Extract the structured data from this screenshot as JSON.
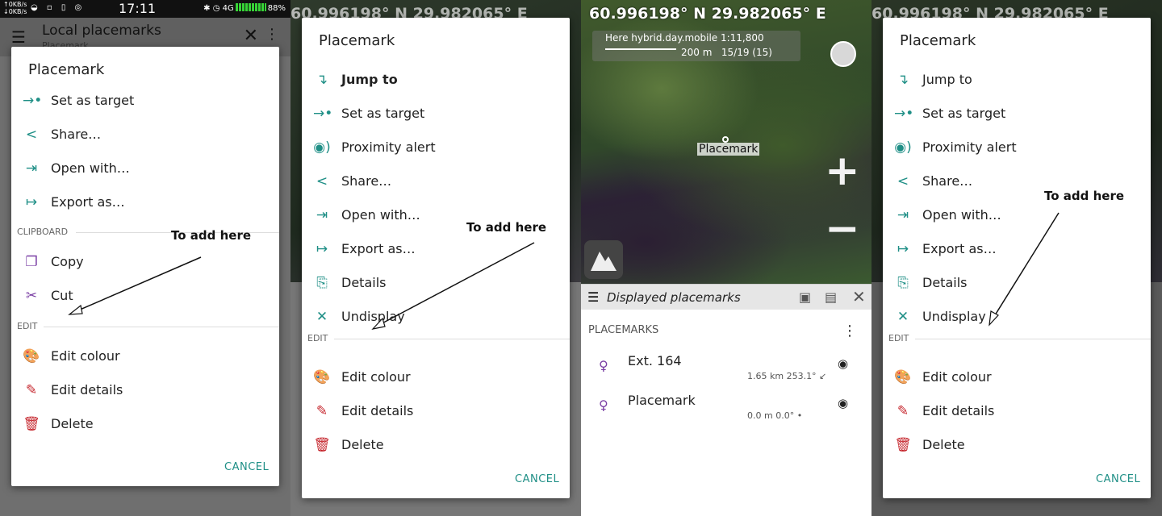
{
  "status": {
    "net_up": "↑0KB/s",
    "net_down": "↓0KB/s",
    "left_icons": "◒ ▫ ▯ ◎",
    "time": "17:11",
    "signal": "4G",
    "battery": "88%"
  },
  "appbar": {
    "title": "Local placemarks",
    "subtitle": "Placemark",
    "menu_icon": "☰",
    "close_icon": "✕",
    "more_icon": "⋮"
  },
  "dialog1": {
    "title": "Placemark",
    "items": [
      {
        "label": "Set as target",
        "icon": "→•"
      },
      {
        "label": "Share…",
        "icon": "<"
      },
      {
        "label": "Open with…",
        "icon": "⇥"
      },
      {
        "label": "Export as…",
        "icon": "↦"
      }
    ],
    "clipboard_header": "CLIPBOARD",
    "clipboard_items": [
      {
        "label": "Copy",
        "icon": "❐"
      },
      {
        "label": "Cut",
        "icon": "✂"
      }
    ],
    "edit_header": "EDIT",
    "edit_items": [
      {
        "label": "Edit colour",
        "icon": "🎨"
      },
      {
        "label": "Edit details",
        "icon": "✎"
      },
      {
        "label": "Delete",
        "icon": "🗑"
      }
    ],
    "cancel": "CANCEL",
    "annotation": "To add here"
  },
  "dialog2": {
    "title": "Placemark",
    "items": [
      {
        "label": "Jump to",
        "icon": "↴"
      },
      {
        "label": "Set as target",
        "icon": "→•"
      },
      {
        "label": "Proximity alert",
        "icon": "◉)"
      },
      {
        "label": "Share…",
        "icon": "<"
      },
      {
        "label": "Open with…",
        "icon": "⇥"
      },
      {
        "label": "Export as…",
        "icon": "↦"
      },
      {
        "label": "Details",
        "icon": "⎘"
      },
      {
        "label": "Undisplay",
        "icon": "✕"
      }
    ],
    "edit_header": "EDIT",
    "edit_items": [
      {
        "label": "Edit colour",
        "icon": "🎨"
      },
      {
        "label": "Edit details",
        "icon": "✎"
      },
      {
        "label": "Delete",
        "icon": "🗑"
      }
    ],
    "cancel": "CANCEL",
    "annotation": "To add here"
  },
  "map": {
    "coordinates": "60.996198° N 29.982065° E",
    "layer_name": "Here hybrid.day.mobile 1:11,800",
    "scale": "200 m",
    "zoom_info": "15/19 (15)",
    "placemark_label": "Placemark",
    "zoom_in": "+",
    "zoom_out": "−"
  },
  "displayed_placemarks": {
    "title": "Displayed placemarks",
    "header": "PLACEMARKS",
    "list_icon": "☰",
    "folder_icon": "▣",
    "filter_icon": "▤",
    "close_icon": "✕",
    "more_icon": "⋮",
    "rows": [
      {
        "name": "Ext. 164",
        "distance": "1.65 km  253.1°  ↙"
      },
      {
        "name": "Placemark",
        "distance": "0.0 m  0.0°  •"
      }
    ]
  },
  "dialog4": {
    "title": "Placemark",
    "items": [
      {
        "label": "Jump to",
        "icon": "↴"
      },
      {
        "label": "Set as target",
        "icon": "→•"
      },
      {
        "label": "Proximity alert",
        "icon": "◉)"
      },
      {
        "label": "Share…",
        "icon": "<"
      },
      {
        "label": "Open with…",
        "icon": "⇥"
      },
      {
        "label": "Export as…",
        "icon": "↦"
      },
      {
        "label": "Details",
        "icon": "⎘"
      },
      {
        "label": "Undisplay",
        "icon": "✕"
      }
    ],
    "edit_header": "EDIT",
    "edit_items": [
      {
        "label": "Edit colour",
        "icon": "🎨"
      },
      {
        "label": "Edit details",
        "icon": "✎"
      },
      {
        "label": "Delete",
        "icon": "🗑"
      }
    ],
    "cancel": "CANCEL",
    "annotation": "To add here"
  },
  "colors": {
    "accent": "#1f8f86",
    "edit_red": "#c6282f",
    "clipboard_purple": "#7a3fa4"
  }
}
